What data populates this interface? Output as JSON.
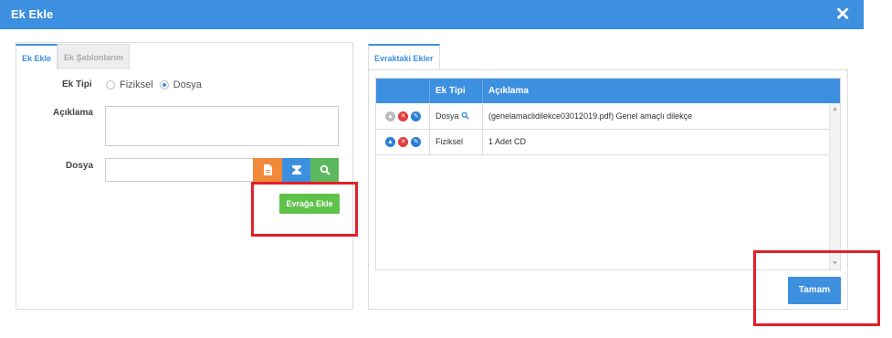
{
  "dialog": {
    "title": "Ek Ekle",
    "close_icon": "close-icon"
  },
  "left_panel": {
    "tabs": [
      {
        "label": "Ek Ekle",
        "active": true
      },
      {
        "label": "Ek Şablonlarım",
        "active": false
      }
    ],
    "ek_tipi": {
      "label": "Ek Tipi",
      "options": [
        "Fiziksel",
        "Dosya"
      ],
      "selected": "Dosya"
    },
    "aciklama": {
      "label": "Açıklama",
      "value": ""
    },
    "dosya": {
      "label": "Dosya",
      "value": "",
      "buttons": [
        "file-icon",
        "scan-icon",
        "search-icon"
      ]
    },
    "add_button": "Evrağa Ekle"
  },
  "right_panel": {
    "tab": "Evraktaki Ekler",
    "columns": [
      "",
      "Ek Tipi",
      "Açıklama"
    ],
    "rows": [
      {
        "ek_tipi": "Dosya",
        "aciklama": "(genelamaclidilekce03012019.pdf) Genel amaçlı dilekçe"
      },
      {
        "ek_tipi": "Fiziksel",
        "aciklama": "1 Adet CD"
      }
    ],
    "ok_button": "Tamam"
  },
  "colors": {
    "accent": "#3d8fdf",
    "highlight": "#e0202a",
    "green": "#5fc24a",
    "orange": "#f1893a"
  }
}
